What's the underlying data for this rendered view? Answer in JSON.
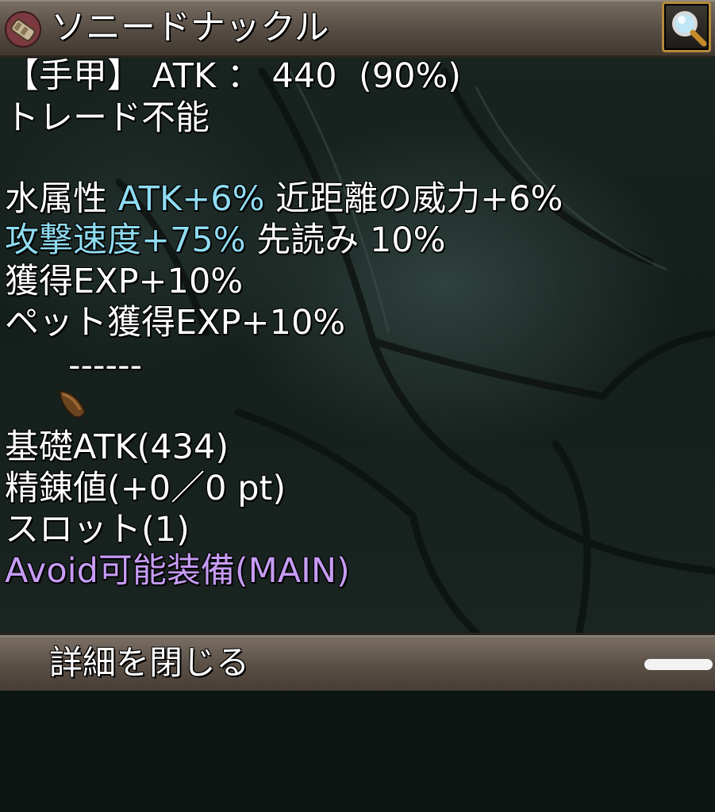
{
  "item": {
    "name": "ソニードナックル",
    "icon": "knuckle-item-icon"
  },
  "toolbar": {
    "search_icon": "magnifier-icon"
  },
  "stats": {
    "type_line": "【手甲】 ATK ： 440  (90%)",
    "trade": "トレード不能",
    "element": "水属性",
    "atk_bonus": "ATK+6%",
    "melee_power": "近距離の威力+6%",
    "attack_speed": "攻撃速度+75%",
    "anticipate": "先読み 10%",
    "exp_gain": "獲得EXP+10%",
    "pet_exp_gain": "ペット獲得EXP+10%",
    "xtal_slot_text": "------",
    "xtal_icon": "seed-icon",
    "base_atk": "基礎ATK(434)",
    "refine": "精錬値(+0／0 pt)",
    "slots": "スロット(1)",
    "avoid": "Avoid可能装備(MAIN)"
  },
  "footer": {
    "close_label": "詳細を閉じる"
  },
  "colors": {
    "cyan_text": "#8fdcf2",
    "purple_text": "#c69cf5",
    "frame_gold": "#b58a3a"
  }
}
